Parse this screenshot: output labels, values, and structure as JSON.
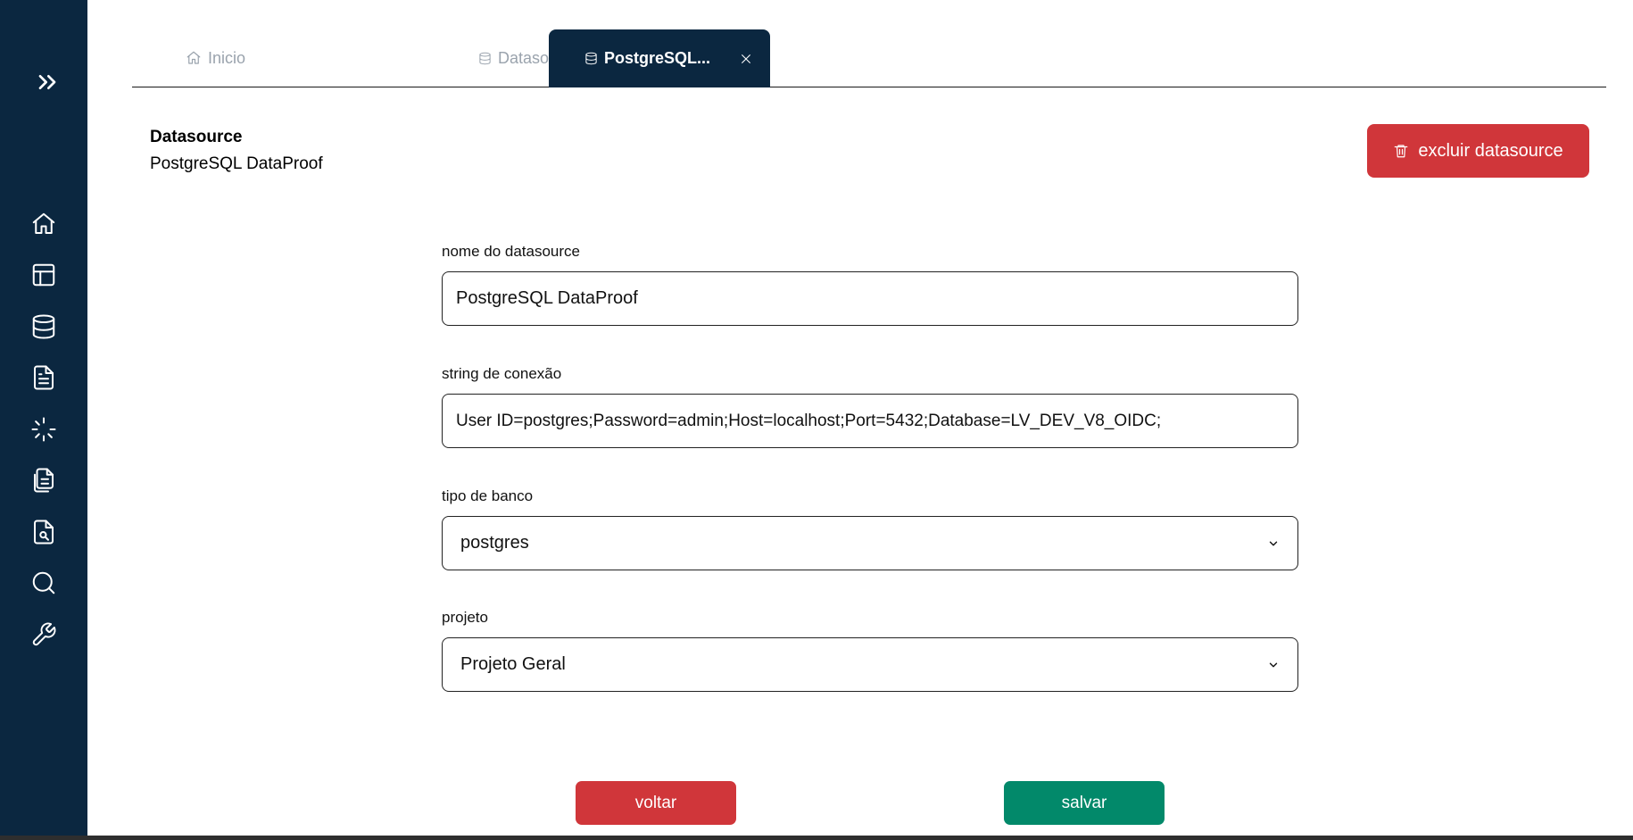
{
  "tabs": {
    "home_label": "Inicio",
    "datasources_label": "Datasource...",
    "active_label": "PostgreSQL..."
  },
  "header": {
    "heading": "Datasource",
    "name": "PostgreSQL DataProof",
    "delete_label": "excluir datasource"
  },
  "form": {
    "name_label": "nome do datasource",
    "name_value": "PostgreSQL DataProof",
    "connection_label": "string de conexão",
    "connection_value": "User ID=postgres;Password=admin;Host=localhost;Port=5432;Database=LV_DEV_V8_OIDC;",
    "db_type_label": "tipo de banco",
    "db_type_value": "postgres",
    "project_label": "projeto",
    "project_value": "Projeto Geral"
  },
  "actions": {
    "back_label": "voltar",
    "save_label": "salvar"
  },
  "colors": {
    "sidebar": "#0b2740",
    "danger": "#d0363a",
    "success": "#02896a"
  },
  "icons": {
    "sidebar": [
      "expand-icon",
      "home-icon",
      "layout-icon",
      "database-icon",
      "file-text-icon",
      "loader-icon",
      "files-icon",
      "file-search-icon",
      "search-icon",
      "wrench-icon"
    ],
    "delete": "trash-icon"
  }
}
